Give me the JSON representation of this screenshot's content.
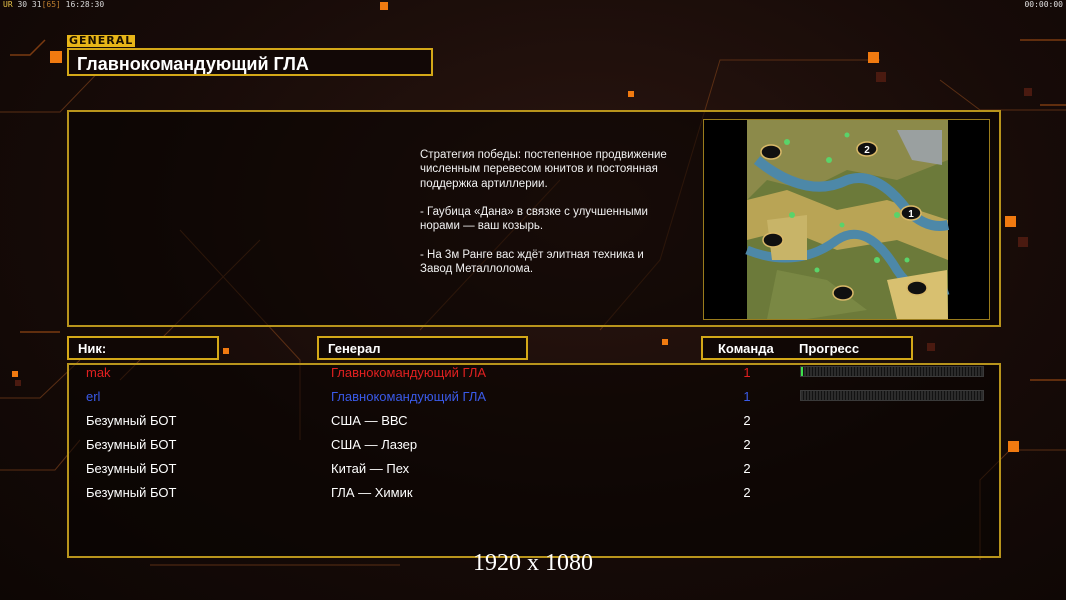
{
  "topbar": {
    "ur_label": "UR",
    "stats": "30 31",
    "pct": "[65]",
    "time": "16:28:30",
    "right_clock": "00:00:00"
  },
  "general_tag": "GENERAL",
  "general_title": "Главнокомандующий ГЛА",
  "description": "Стратегия победы: постепенное продвижение численным перевесом юнитов и постоянная поддержка артиллерии.\n\n- Гаубица «Дана» в связке с улучшенными норами — ваш козырь.\n\n- На 3м Ранге вас ждёт элитная техника и Завод Металлолома.",
  "map": {
    "markers": [
      "2",
      "1"
    ]
  },
  "headers": {
    "nick": "Ник:",
    "general": "Генерал",
    "team": "Команда",
    "progress": "Прогресс"
  },
  "players": [
    {
      "nick": "mak",
      "general": "Главнокомандующий ГЛА",
      "team": "1",
      "color": "#e02020",
      "team_color": "#e02020",
      "progress": 0.01
    },
    {
      "nick": "erl",
      "general": "Главнокомандующий ГЛА",
      "team": "1",
      "color": "#3a5ae8",
      "team_color": "#3a5ae8",
      "progress": 0
    },
    {
      "nick": "Безумный БОТ",
      "general": "США — ВВС",
      "team": "2",
      "color": "#ffffff",
      "team_color": "#ffffff"
    },
    {
      "nick": "Безумный БОТ",
      "general": "США — Лазер",
      "team": "2",
      "color": "#ffffff",
      "team_color": "#ffffff"
    },
    {
      "nick": "Безумный БОТ",
      "general": "Китай — Пех",
      "team": "2",
      "color": "#ffffff",
      "team_color": "#ffffff"
    },
    {
      "nick": "Безумный БОТ",
      "general": "ГЛА — Химик",
      "team": "2",
      "color": "#ffffff",
      "team_color": "#ffffff"
    }
  ],
  "watermark": "1920 x 1080",
  "colors": {
    "accent_gold": "#d4a818",
    "orange_square": "#f07a10"
  }
}
